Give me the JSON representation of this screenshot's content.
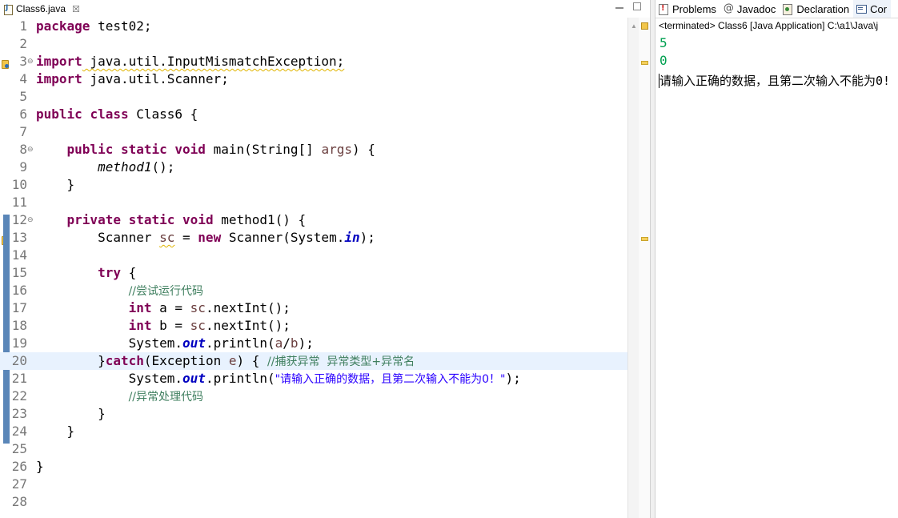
{
  "editor": {
    "tab_title": "Class6.java",
    "close_glyph": "☒",
    "lines": {
      "n1": "1",
      "n2": "2",
      "n3": "3",
      "n4": "4",
      "n5": "5",
      "n6": "6",
      "n7": "7",
      "n8": "8",
      "n9": "9",
      "n10": "10",
      "n11": "11",
      "n12": "12",
      "n13": "13",
      "n14": "14",
      "n15": "15",
      "n16": "16",
      "n17": "17",
      "n18": "18",
      "n19": "19",
      "n20": "20",
      "n21": "21",
      "n22": "22",
      "n23": "23",
      "n24": "24",
      "n25": "25",
      "n26": "26",
      "n27": "27",
      "n28": "28"
    },
    "code": {
      "kw_package": "package",
      "pkg_name": " test02;",
      "kw_import": "import",
      "import1": " java.util.InputMismatchException;",
      "import2": " java.util.Scanner;",
      "kw_public": "public",
      "kw_class": "class",
      "class_decl": " Class6 {",
      "kw_static": "static",
      "kw_void": "void",
      "main_sig": " main(String[] ",
      "args": "args",
      "main_end": ") {",
      "method1_call": "method1",
      "call_end": "();",
      "brace_close": "}",
      "kw_private": "private",
      "method1_sig": " method1() {",
      "scanner_type": "Scanner ",
      "sc": "sc",
      "eq": " = ",
      "kw_new": "new",
      "scanner_ctor": " Scanner(System.",
      "in": "in",
      "ctor_end": ");",
      "kw_try": "try",
      "open_brace": " {",
      "comment1": "//尝试运行代码",
      "kw_int": "int",
      "int_a": " a = ",
      "int_b": " b = ",
      "next_int": ".nextInt();",
      "system": "System.",
      "out": "out",
      "println_ab_1": ".println(",
      "a": "a",
      "slash": "/",
      "b": "b",
      "println_ab_end": ");",
      "catch_open": "}",
      "kw_catch": "catch",
      "catch_sig": "(Exception ",
      "e": "e",
      "catch_end": ") { ",
      "comment2": "//捕获异常  异常类型+异常名",
      "println_open": ".println(",
      "msg_string": "\"请输入正确的数据，且第二次输入不能为0！\"",
      "println_close": ");",
      "comment3": "//异常处理代码"
    }
  },
  "views": {
    "tabs": [
      {
        "label": "Problems"
      },
      {
        "label": "Javadoc"
      },
      {
        "label": "Declaration"
      },
      {
        "label": "Cor"
      }
    ]
  },
  "console": {
    "status": "<terminated> Class6 [Java Application] C:\\a1\\Java\\j",
    "input1": "5",
    "input2": "0",
    "output": "请输入正确的数据，且第二次输入不能为0!"
  },
  "colors": {
    "keyword": "#7f0055",
    "comment": "#3f7f5f",
    "string": "#2a00ff",
    "static_field": "#0000c0",
    "local_var": "#6a3e3e",
    "console_input": "#00a050",
    "current_line": "#e8f2fe"
  }
}
